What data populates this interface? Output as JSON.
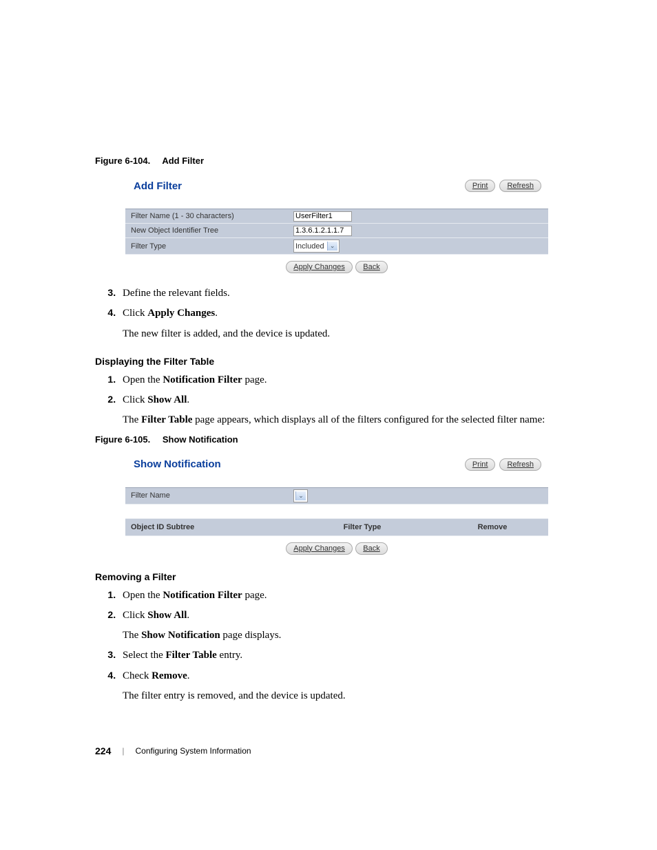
{
  "figure1": {
    "caption_num": "Figure 6-104.",
    "caption_title": "Add Filter",
    "title": "Add Filter",
    "print": "Print",
    "refresh": "Refresh",
    "rows": {
      "r1_label": "Filter Name (1 - 30 characters)",
      "r1_value": "UserFilter1",
      "r2_label": "New Object Identifier Tree",
      "r2_value": "1.3.6.1.2.1.1.7",
      "r3_label": "Filter Type",
      "r3_value": "Included"
    },
    "apply": "Apply Changes",
    "back": "Back"
  },
  "steps1": {
    "s3": "Define the relevant fields.",
    "s4a": "Click ",
    "s4b": "Apply Changes",
    "s4c": ".",
    "s4_follow": "The new filter is added, and the device is updated."
  },
  "section2": {
    "heading": "Displaying the Filter Table",
    "s1a": "Open the ",
    "s1b": "Notification Filter",
    "s1c": " page.",
    "s2a": "Click ",
    "s2b": "Show All",
    "s2c": ".",
    "s2_follow_a": "The ",
    "s2_follow_b": "Filter Table",
    "s2_follow_c": " page appears, which displays all of the filters configured for the selected filter name:"
  },
  "figure2": {
    "caption_num": "Figure 6-105.",
    "caption_title": "Show Notification",
    "title": "Show Notification",
    "print": "Print",
    "refresh": "Refresh",
    "row_label": "Filter Name",
    "col1": "Object ID Subtree",
    "col2": "Filter Type",
    "col3": "Remove",
    "apply": "Apply Changes",
    "back": "Back"
  },
  "section3": {
    "heading": "Removing a Filter",
    "s1a": "Open the ",
    "s1b": "Notification Filter",
    "s1c": " page.",
    "s2a": "Click ",
    "s2b": "Show All",
    "s2c": ".",
    "s2_follow_a": "The ",
    "s2_follow_b": "Show Notification",
    "s2_follow_c": " page displays.",
    "s3a": "Select the ",
    "s3b": "Filter Table",
    "s3c": " entry.",
    "s4a": "Check ",
    "s4b": "Remove",
    "s4c": ".",
    "s4_follow": "The filter entry is removed, and the device is updated."
  },
  "footer": {
    "page_num": "224",
    "divider": "|",
    "chapter": "Configuring System Information"
  }
}
